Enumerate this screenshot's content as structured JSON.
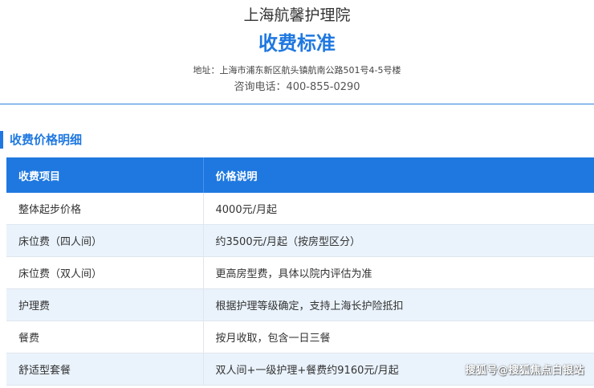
{
  "header": {
    "org_name": "上海航馨护理院",
    "title": "收费标准",
    "address": "地址：上海市浦东新区航头镇航南公路501号4-5号楼",
    "phone": "咨询电话：400-855-0290"
  },
  "section": {
    "title": "收费价格明细"
  },
  "table": {
    "headers": [
      "收费项目",
      "价格说明"
    ],
    "rows": [
      [
        "整体起步价格",
        "4000元/月起"
      ],
      [
        "床位费（四人间）",
        "约3500元/月起（按房型区分）"
      ],
      [
        "床位费（双人间）",
        "更高房型费，具体以院内评估为准"
      ],
      [
        "护理费",
        "根据护理等级确定，支持上海长护险抵扣"
      ],
      [
        "餐费",
        "按月收取，包含一日三餐"
      ],
      [
        "舒适型套餐",
        "双人间+一级护理+餐费约9160元/月起"
      ]
    ]
  },
  "watermark": "搜狐号@搜狐焦点白银站",
  "colors": {
    "accent": "#1f78e0",
    "row_alt": "#eaf3fc"
  }
}
